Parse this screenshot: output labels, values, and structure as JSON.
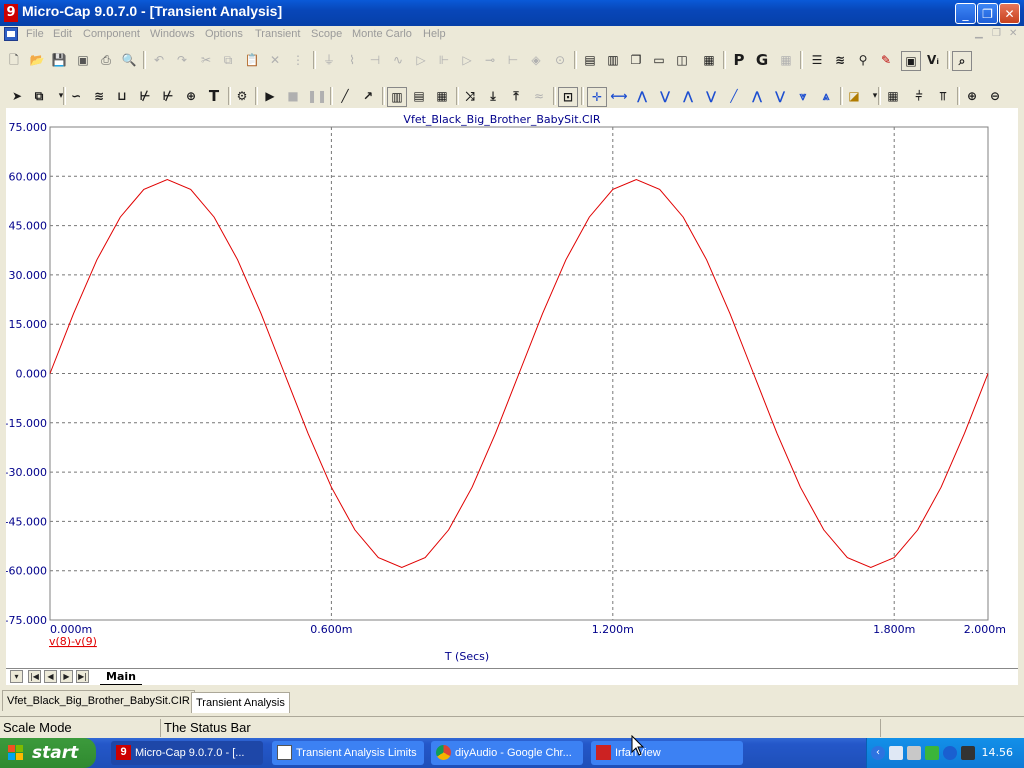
{
  "window": {
    "app_icon_glyph": "9",
    "title": "Micro-Cap 9.0.7.0 - [Transient Analysis]",
    "minimize_glyph": "_",
    "restore_glyph": "❐",
    "close_glyph": "✕"
  },
  "menu": {
    "items": [
      "File",
      "Edit",
      "Component",
      "Windows",
      "Options",
      "Transient",
      "Scope",
      "Monte Carlo",
      "Help"
    ]
  },
  "toolbar2": {
    "text_tool": "T",
    "p_button": "P",
    "g_button": "G"
  },
  "chart_data": {
    "type": "line",
    "title": "Vfet_Black_Big_Brother_BabySit.CIR",
    "xlabel": "T (Secs)",
    "ylabel": "",
    "xlim": [
      0,
      2.0
    ],
    "ylim": [
      -75,
      75
    ],
    "x_ticks": [
      0,
      0.6,
      1.2,
      1.8,
      2.0
    ],
    "x_tick_labels": [
      "0.000m",
      "0.600m",
      "1.200m",
      "1.800m",
      "2.000m"
    ],
    "y_ticks": [
      75,
      60,
      45,
      30,
      15,
      0,
      -15,
      -30,
      -45,
      -60,
      -75
    ],
    "y_tick_labels": [
      "75.000",
      "60.000",
      "45.000",
      "30.000",
      "15.000",
      "0.000",
      "-15.000",
      "-30.000",
      "-45.000",
      "-60.000",
      "-75.000"
    ],
    "grid": true,
    "series": [
      {
        "name": "v(8)-v(9)",
        "color": "#e00000",
        "x": [
          0,
          0.05,
          0.1,
          0.15,
          0.2,
          0.25,
          0.3,
          0.35,
          0.4,
          0.45,
          0.5,
          0.55,
          0.6,
          0.65,
          0.7,
          0.75,
          0.8,
          0.85,
          0.9,
          0.95,
          1.0,
          1.05,
          1.1,
          1.15,
          1.2,
          1.25,
          1.3,
          1.35,
          1.4,
          1.45,
          1.5,
          1.55,
          1.6,
          1.65,
          1.7,
          1.75,
          1.8,
          1.85,
          1.9,
          1.95,
          2.0
        ],
        "values": [
          0,
          18.2,
          34.6,
          47.6,
          56.0,
          59.0,
          56.0,
          47.6,
          34.6,
          18.2,
          0,
          -18.2,
          -34.6,
          -47.6,
          -56.0,
          -59.0,
          -56.0,
          -47.6,
          -34.6,
          -18.2,
          0,
          18.2,
          34.6,
          47.6,
          56.0,
          59.0,
          56.0,
          47.6,
          34.6,
          18.2,
          0,
          -18.2,
          -34.6,
          -47.6,
          -56.0,
          -59.0,
          -56.0,
          -47.6,
          -34.6,
          -18.2,
          0
        ]
      }
    ]
  },
  "sheet_tabs": {
    "active": "Main"
  },
  "doc_tabs": [
    "Vfet_Black_Big_Brother_BabySit.CIR",
    "Transient Analysis"
  ],
  "status": {
    "mode": "Scale Mode",
    "message": "The Status Bar"
  },
  "taskbar": {
    "start_label": "start",
    "tasks": [
      "Micro-Cap 9.0.7.0 - [...",
      "Transient Analysis Limits",
      "diyAudio - Google Chr...",
      "IrfanView"
    ],
    "clock": "14.56"
  },
  "colors": {
    "trace": "#e00000",
    "axis_text": "#00008b",
    "title_blue": "#0a5ad8"
  }
}
